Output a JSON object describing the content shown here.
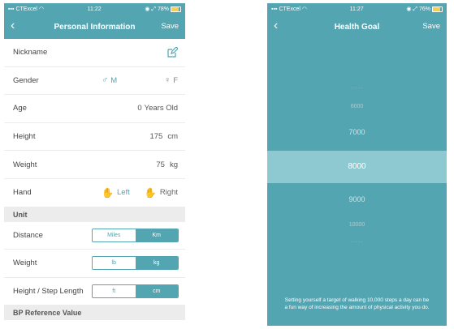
{
  "left": {
    "status": {
      "carrier": "CTExcel",
      "time": "11:22",
      "battery": "78%"
    },
    "nav": {
      "title": "Personal Information",
      "save": "Save"
    },
    "rows": {
      "nickname": {
        "label": "Nickname"
      },
      "gender": {
        "label": "Gender",
        "male": "M",
        "female": "F"
      },
      "age": {
        "label": "Age",
        "value": "0",
        "unit": "Years Old"
      },
      "height": {
        "label": "Height",
        "value": "175",
        "unit": "cm"
      },
      "weight": {
        "label": "Weight",
        "value": "75",
        "unit": "kg"
      },
      "hand": {
        "label": "Hand",
        "left": "Left",
        "right": "Right",
        "selected": "Left"
      }
    },
    "unit_section": "Unit",
    "units": {
      "distance": {
        "label": "Distance",
        "opt1": "Miles",
        "opt2": "Km",
        "selected": "Km"
      },
      "weight": {
        "label": "Weight",
        "opt1": "lb",
        "opt2": "kg",
        "selected": "kg"
      },
      "step": {
        "label": "Height / Step Length",
        "opt1": "ft",
        "opt2": "cm",
        "selected": "cm"
      }
    },
    "bp_section": "BP Reference Value"
  },
  "right": {
    "status": {
      "carrier": "CTExcel",
      "time": "11:27",
      "battery": "76%"
    },
    "nav": {
      "title": "Health Goal",
      "save": "Save"
    },
    "picker": {
      "values": [
        "6000",
        "7000",
        "8000",
        "9000",
        "10000"
      ],
      "selected": "8000"
    },
    "description": "Setting yourself a target of walking 10,000 steps a day can be a fun way of increasing the amount of physical activity you do."
  },
  "colors": {
    "accent": "#54a5b2",
    "highlight": "#8ec9d1",
    "section": "#ececec"
  }
}
